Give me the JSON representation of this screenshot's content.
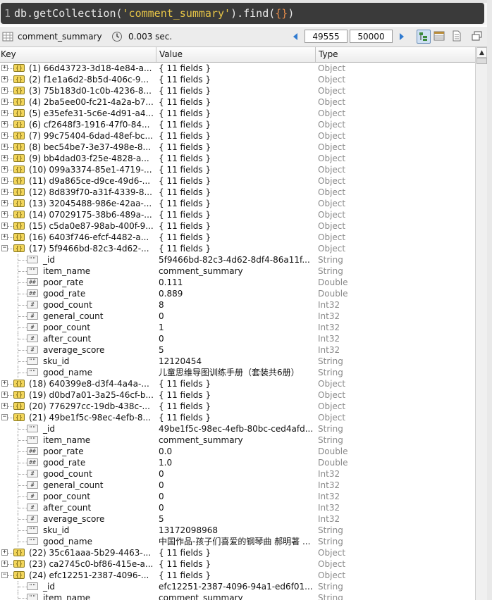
{
  "query": {
    "line_number": "1",
    "prefix": "db.getCollection(",
    "collection_literal": "'comment_summary'",
    "middle": ").find(",
    "braces": "{}",
    "suffix": ")"
  },
  "toolbar": {
    "collection_name": "comment_summary",
    "elapsed": "0.003 sec.",
    "page_start": "49555",
    "page_end": "50000"
  },
  "columns": {
    "key": "Key",
    "value": "Value",
    "type": "Type"
  },
  "rows": [
    {
      "kind": "obj",
      "expanded": false,
      "key": "(1) 66d43723-3d18-4e84-a...",
      "value": "{ 11 fields }",
      "type": "Object"
    },
    {
      "kind": "obj",
      "expanded": false,
      "key": "(2) f1e1a6d2-8b5d-406c-9...",
      "value": "{ 11 fields }",
      "type": "Object"
    },
    {
      "kind": "obj",
      "expanded": false,
      "key": "(3) 75b183d0-1c0b-4236-8...",
      "value": "{ 11 fields }",
      "type": "Object"
    },
    {
      "kind": "obj",
      "expanded": false,
      "key": "(4) 2ba5ee00-fc21-4a2a-b7...",
      "value": "{ 11 fields }",
      "type": "Object"
    },
    {
      "kind": "obj",
      "expanded": false,
      "key": "(5) e35efe31-5c6e-4d91-a4...",
      "value": "{ 11 fields }",
      "type": "Object"
    },
    {
      "kind": "obj",
      "expanded": false,
      "key": "(6) cf2648f3-1916-47f0-84...",
      "value": "{ 11 fields }",
      "type": "Object"
    },
    {
      "kind": "obj",
      "expanded": false,
      "key": "(7) 99c75404-6dad-48ef-bc...",
      "value": "{ 11 fields }",
      "type": "Object"
    },
    {
      "kind": "obj",
      "expanded": false,
      "key": "(8) bec54be7-3e37-498e-8...",
      "value": "{ 11 fields }",
      "type": "Object"
    },
    {
      "kind": "obj",
      "expanded": false,
      "key": "(9) bb4dad03-f25e-4828-a...",
      "value": "{ 11 fields }",
      "type": "Object"
    },
    {
      "kind": "obj",
      "expanded": false,
      "key": "(10) 099a3374-85e1-4719-...",
      "value": "{ 11 fields }",
      "type": "Object"
    },
    {
      "kind": "obj",
      "expanded": false,
      "key": "(11) d9a865ce-d9ce-49d6-...",
      "value": "{ 11 fields }",
      "type": "Object"
    },
    {
      "kind": "obj",
      "expanded": false,
      "key": "(12) 8d839f70-a31f-4339-8...",
      "value": "{ 11 fields }",
      "type": "Object"
    },
    {
      "kind": "obj",
      "expanded": false,
      "key": "(13) 32045488-986e-42aa-...",
      "value": "{ 11 fields }",
      "type": "Object"
    },
    {
      "kind": "obj",
      "expanded": false,
      "key": "(14) 07029175-38b6-489a-...",
      "value": "{ 11 fields }",
      "type": "Object"
    },
    {
      "kind": "obj",
      "expanded": false,
      "key": "(15) c5da0e87-98ab-400f-9...",
      "value": "{ 11 fields }",
      "type": "Object"
    },
    {
      "kind": "obj",
      "expanded": false,
      "key": "(16) 6403f746-efcf-4482-a...",
      "value": "{ 11 fields }",
      "type": "Object"
    },
    {
      "kind": "obj",
      "expanded": true,
      "key": "(17) 5f9466bd-82c3-4d62-...",
      "value": "{ 11 fields }",
      "type": "Object"
    },
    {
      "kind": "fld",
      "icon": "\"\"",
      "key": "_id",
      "value": "5f9466bd-82c3-4d62-8df4-86a11f...",
      "type": "String"
    },
    {
      "kind": "fld",
      "icon": "\"\"",
      "key": "item_name",
      "value": "comment_summary",
      "type": "String"
    },
    {
      "kind": "fld",
      "icon": "##",
      "key": "poor_rate",
      "value": "0.111",
      "type": "Double"
    },
    {
      "kind": "fld",
      "icon": "##",
      "key": "good_rate",
      "value": "0.889",
      "type": "Double"
    },
    {
      "kind": "fld",
      "icon": "#",
      "key": "good_count",
      "value": "8",
      "type": "Int32"
    },
    {
      "kind": "fld",
      "icon": "#",
      "key": "general_count",
      "value": "0",
      "type": "Int32"
    },
    {
      "kind": "fld",
      "icon": "#",
      "key": "poor_count",
      "value": "1",
      "type": "Int32"
    },
    {
      "kind": "fld",
      "icon": "#",
      "key": "after_count",
      "value": "0",
      "type": "Int32"
    },
    {
      "kind": "fld",
      "icon": "#",
      "key": "average_score",
      "value": "5",
      "type": "Int32"
    },
    {
      "kind": "fld",
      "icon": "\"\"",
      "key": "sku_id",
      "value": "12120454",
      "type": "String"
    },
    {
      "kind": "fld",
      "icon": "\"\"",
      "key": "good_name",
      "value": "儿童思维导图训练手册（套装共6册）",
      "type": "String"
    },
    {
      "kind": "obj",
      "expanded": false,
      "key": "(18) 640399e8-d3f4-4a4a-...",
      "value": "{ 11 fields }",
      "type": "Object"
    },
    {
      "kind": "obj",
      "expanded": false,
      "key": "(19) d0bd7a01-3a25-46cf-b...",
      "value": "{ 11 fields }",
      "type": "Object"
    },
    {
      "kind": "obj",
      "expanded": false,
      "key": "(20) 776297cc-19db-438c-...",
      "value": "{ 11 fields }",
      "type": "Object"
    },
    {
      "kind": "obj",
      "expanded": true,
      "key": "(21) 49be1f5c-98ec-4efb-8...",
      "value": "{ 11 fields }",
      "type": "Object"
    },
    {
      "kind": "fld",
      "icon": "\"\"",
      "key": "_id",
      "value": "49be1f5c-98ec-4efb-80bc-ced4afd...",
      "type": "String"
    },
    {
      "kind": "fld",
      "icon": "\"\"",
      "key": "item_name",
      "value": "comment_summary",
      "type": "String"
    },
    {
      "kind": "fld",
      "icon": "##",
      "key": "poor_rate",
      "value": "0.0",
      "type": "Double"
    },
    {
      "kind": "fld",
      "icon": "##",
      "key": "good_rate",
      "value": "1.0",
      "type": "Double"
    },
    {
      "kind": "fld",
      "icon": "#",
      "key": "good_count",
      "value": "0",
      "type": "Int32"
    },
    {
      "kind": "fld",
      "icon": "#",
      "key": "general_count",
      "value": "0",
      "type": "Int32"
    },
    {
      "kind": "fld",
      "icon": "#",
      "key": "poor_count",
      "value": "0",
      "type": "Int32"
    },
    {
      "kind": "fld",
      "icon": "#",
      "key": "after_count",
      "value": "0",
      "type": "Int32"
    },
    {
      "kind": "fld",
      "icon": "#",
      "key": "average_score",
      "value": "5",
      "type": "Int32"
    },
    {
      "kind": "fld",
      "icon": "\"\"",
      "key": "sku_id",
      "value": "13172098968",
      "type": "String"
    },
    {
      "kind": "fld",
      "icon": "\"\"",
      "key": "good_name",
      "value": "中国作品-孩子们喜爱的钢琴曲 郝明著 ...",
      "type": "String"
    },
    {
      "kind": "obj",
      "expanded": false,
      "key": "(22) 35c61aaa-5b29-4463-...",
      "value": "{ 11 fields }",
      "type": "Object"
    },
    {
      "kind": "obj",
      "expanded": false,
      "key": "(23) ca2745c0-bf86-415e-a...",
      "value": "{ 11 fields }",
      "type": "Object"
    },
    {
      "kind": "obj",
      "expanded": true,
      "key": "(24) efc12251-2387-4096-...",
      "value": "{ 11 fields }",
      "type": "Object"
    },
    {
      "kind": "fld",
      "icon": "\"\"",
      "key": "_id",
      "value": "efc12251-2387-4096-94a1-ed6f01...",
      "type": "String"
    },
    {
      "kind": "fld",
      "icon": "\"\"",
      "key": "item_name",
      "value": "comment_summary",
      "type": "String"
    }
  ]
}
